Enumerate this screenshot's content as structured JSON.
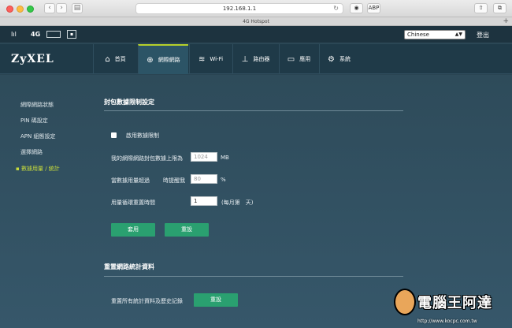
{
  "browser": {
    "url": "192.168.1.1",
    "tab_title": "4G Hotspot",
    "new_tab": "+",
    "back": "‹",
    "forward": "›",
    "reload": "↻",
    "share": "⇧",
    "tabs_btn": "⧉"
  },
  "status": {
    "signal": "Iıl",
    "network": "4G",
    "language": "Chinese",
    "logout": "登出"
  },
  "brand": "ZyXEL",
  "nav": [
    {
      "label": "首頁",
      "icon": "⌂"
    },
    {
      "label": "網際網路",
      "icon": "⊕"
    },
    {
      "label": "Wi-Fi",
      "icon": "≋"
    },
    {
      "label": "路由器",
      "icon": "⊥"
    },
    {
      "label": "應用",
      "icon": "▭"
    },
    {
      "label": "系統",
      "icon": "⚙"
    }
  ],
  "sidebar": [
    {
      "label": "網際網路狀態"
    },
    {
      "label": "PIN 碼設定"
    },
    {
      "label": "APN 組態設定"
    },
    {
      "label": "選擇網路"
    },
    {
      "label": "數據用量 / 統計",
      "active": true
    }
  ],
  "limit_section": {
    "title": "封包數據限制設定",
    "enable_label": "啟用數據限制",
    "cap_label": "我的網際網路封包數據上限為",
    "cap_value": "1024",
    "cap_unit": "MB",
    "alert_label": "當數據用量超過",
    "alert_label2": "時提醒我",
    "alert_value": "80",
    "alert_unit": "%",
    "reset_label": "用量循環重置時間",
    "reset_value": "1",
    "reset_unit": "(每月第　天)",
    "apply_btn": "套用",
    "reset_btn": "重設"
  },
  "stats_section": {
    "title": "重置網路統計資料",
    "reset_all_label": "重置所有統計資料及歷史記錄",
    "reset_all_btn": "重設"
  },
  "watermark": {
    "text": "電腦王阿達",
    "url": "http://www.kocpc.com.tw"
  }
}
